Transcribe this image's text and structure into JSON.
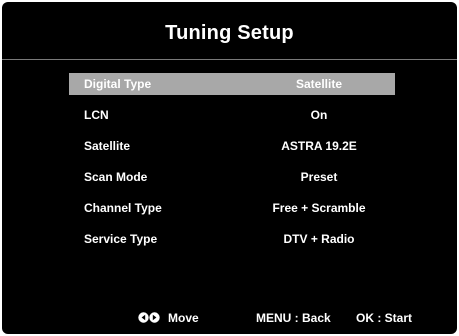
{
  "header": {
    "title": "Tuning Setup"
  },
  "menu": {
    "items": [
      {
        "label": "Digital Type",
        "value": "Satellite",
        "selected": true
      },
      {
        "label": "LCN",
        "value": "On"
      },
      {
        "label": "Satellite",
        "value": "ASTRA 19.2E"
      },
      {
        "label": "Scan Mode",
        "value": "Preset"
      },
      {
        "label": "Channel Type",
        "value": "Free + Scramble"
      },
      {
        "label": "Service Type",
        "value": "DTV + Radio"
      }
    ]
  },
  "footer": {
    "move_label": "Move",
    "move_icons": [
      "left-arrow-button-icon",
      "right-arrow-button-icon"
    ],
    "back_label": "MENU : Back",
    "start_label": "OK : Start"
  },
  "colors": {
    "background": "#000000",
    "text": "#ffffff",
    "selection_highlight": "#a8a8a8",
    "divider": "#7a7a7a"
  }
}
